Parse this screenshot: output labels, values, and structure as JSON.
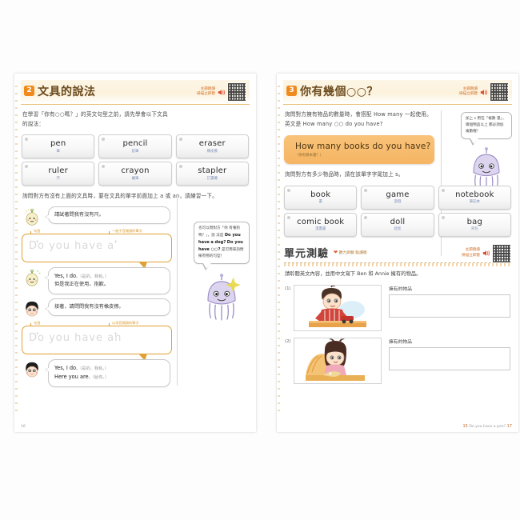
{
  "left_page": {
    "section": {
      "number": "2",
      "title": "文具的說法",
      "audio_label": "主題朗讀\n掃描立即聽",
      "audio_icon": "speaker-icon",
      "qr_icon": "qr-code-icon"
    },
    "intro": "在學習「你有○○嗎？」的英文句型之前，請先學會以下文具的說法：",
    "word_cards": [
      {
        "en": "pen",
        "zh": "筆"
      },
      {
        "en": "pencil",
        "zh": "鉛筆"
      },
      {
        "en": "eraser",
        "zh": "橡皮擦"
      },
      {
        "en": "ruler",
        "zh": "尺"
      },
      {
        "en": "crayon",
        "zh": "蠟筆"
      },
      {
        "en": "stapler",
        "zh": "訂書機"
      }
    ],
    "intro2": "詢問對方有沒有上面的文具時，要在文具的單字前面加上 a 或 an，請練習一下。",
    "dialogue": [
      {
        "avatar": "onion-character-avatar",
        "lines": [
          {
            "text": "請試著問我有沒有尺。",
            "style": "zh"
          }
        ]
      }
    ],
    "practice1": {
      "handwriting": "Do you have a",
      "tag_left": "句首",
      "tag_right": "一般子音開頭的單字",
      "cross_mark": "+"
    },
    "dialogue2": [
      {
        "avatar": "onion-character-avatar",
        "lines": [
          {
            "text": "Yes, I do.",
            "style": "en"
          },
          {
            "text": "（是的，我有。）",
            "style": "gray"
          },
          {
            "text": "但是我正在使用，抱歉。",
            "style": "zh"
          }
        ]
      },
      {
        "avatar": "boy-character-avatar",
        "lines": [
          {
            "text": "接著，請問問我有沒有橡皮擦。",
            "style": "zh"
          }
        ]
      }
    ],
    "practice2": {
      "handwriting": "Do you have an",
      "tag_left": "句首",
      "tag_right": "以母音開頭的單字",
      "cross_mark": "+"
    },
    "dialogue3": [
      {
        "avatar": "boy-character-avatar",
        "lines": [
          {
            "text": "Yes, I do.",
            "style": "en"
          },
          {
            "text": "（是的，我有。）",
            "style": "gray"
          },
          {
            "text": "Here you are.",
            "style": "en"
          },
          {
            "text": "（給你。）",
            "style": "gray"
          }
        ]
      }
    ],
    "side_note": {
      "text_lines": [
        "也可以問對方「你",
        "有養狗嗎？」，說",
        "法是"
      ],
      "bold1": "Do you have",
      "bold1b": "a dog?",
      "bold2": "Do you have ○○?",
      "tail": "是可用來詢問擁有物的句型！",
      "character": "jellyfish-character"
    },
    "footer": "16"
  },
  "right_page": {
    "section": {
      "number": "3",
      "title": "你有幾個○○？",
      "audio_label": "主題朗讀\n掃描立即聽",
      "audio_icon": "speaker-icon",
      "qr_icon": "qr-code-icon"
    },
    "intro": "詢問對方擁有物品的數量時，會搭配 How many 一起使用。英文是 How many ○○ do you have?",
    "sentence_box": {
      "en": "How many books do you have?",
      "zh": "（你有幾本書？）"
    },
    "intro2": "詢問對方有多少物品時，請在該單字字尾加上 s。",
    "word_cards": [
      {
        "en": "book",
        "zh": "書"
      },
      {
        "en": "game",
        "zh": "遊戲"
      },
      {
        "en": "notebook",
        "zh": "筆記本"
      },
      {
        "en": "comic book",
        "zh": "漫畫書"
      },
      {
        "en": "doll",
        "zh": "娃娃"
      },
      {
        "en": "bag",
        "zh": "背包"
      }
    ],
    "side_note": {
      "text_lines": [
        "加上 s 用在「複數",
        "量」，兩個物品以上",
        "都必須加複數喔！"
      ],
      "character": "jellyfish-character"
    },
    "unit_test": {
      "title": "單元測驗",
      "subtitle": "聽力測驗 點讀版",
      "audio_label": "主題朗讀\n掃描立即聽",
      "instruction": "請聆聽英文內容，並用中文寫下 Ben 和 Annie 擁有的物品。",
      "questions": [
        {
          "num": "(1)",
          "label": "擁有的物品",
          "answer": "",
          "image": "boy-with-toy-car-illustration"
        },
        {
          "num": "(2)",
          "label": "擁有的物品",
          "answer": "",
          "image": "girl-with-doll-illustration"
        }
      ]
    },
    "footer": {
      "page": "15",
      "text": "Do you have a pen?",
      "page_right": "17"
    }
  }
}
